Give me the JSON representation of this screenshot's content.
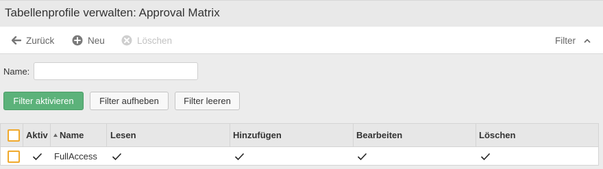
{
  "title": "Tabellenprofile verwalten: Approval Matrix",
  "toolbar": {
    "back_label": "Zurück",
    "new_label": "Neu",
    "delete_label": "Löschen",
    "filter_label": "Filter"
  },
  "filter": {
    "name_label": "Name:",
    "name_value": "",
    "activate_label": "Filter aktivieren",
    "remove_label": "Filter aufheben",
    "clear_label": "Filter leeren"
  },
  "table": {
    "columns": {
      "aktiv": "Aktiv",
      "name": "Name",
      "lesen": "Lesen",
      "hinzufuegen": "Hinzufügen",
      "bearbeiten": "Bearbeiten",
      "loeschen": "Löschen"
    },
    "rows": [
      {
        "aktiv": true,
        "name": "FullAccess",
        "lesen": true,
        "hinzufuegen": true,
        "bearbeiten": true,
        "loeschen": true
      }
    ]
  },
  "colors": {
    "primary_button": "#5cb27a",
    "checkbox_border": "#f0a92c",
    "header_bg": "#e7e7e7"
  },
  "icons": {
    "back": "arrow-left-icon",
    "new": "plus-circle-icon",
    "delete": "x-circle-icon",
    "filter_toggle": "chevron-up-icon",
    "sort": "sort-asc-icon",
    "check": "check-icon"
  }
}
